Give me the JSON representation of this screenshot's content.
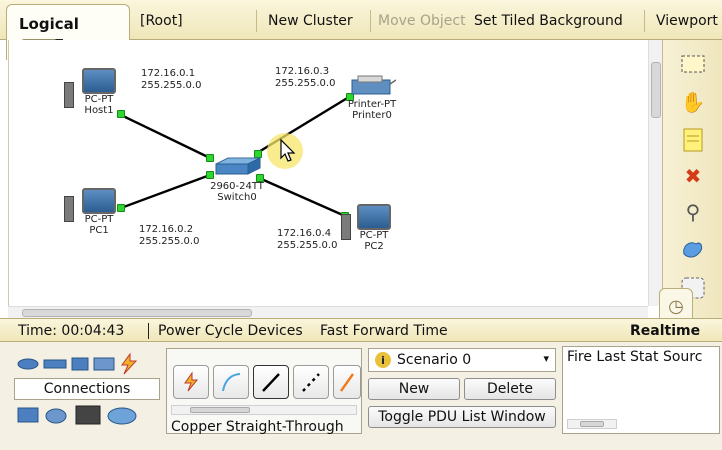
{
  "toolbar": {
    "logical": "Logical",
    "root": "[Root]",
    "new_cluster": "New Cluster",
    "move_object": "Move Object",
    "set_tiled_background": "Set Tiled Background",
    "viewport": "Viewport"
  },
  "devices": {
    "host1": {
      "type": "PC-PT",
      "name": "Host1",
      "ip": "172.16.0.1",
      "mask": "255.255.0.0"
    },
    "pc1": {
      "type": "PC-PT",
      "name": "PC1",
      "ip": "172.16.0.2",
      "mask": "255.255.0.0"
    },
    "switch0": {
      "type": "2960-24TT",
      "name": "Switch0"
    },
    "printer0": {
      "type": "Printer-PT",
      "name": "Printer0",
      "ip": "172.16.0.3",
      "mask": "255.255.0.0"
    },
    "pc2": {
      "type": "PC-PT",
      "name": "PC2",
      "ip": "172.16.0.4",
      "mask": "255.255.0.0"
    }
  },
  "time_bar": {
    "time": "Time: 00:04:43",
    "power_cycle": "Power Cycle Devices",
    "fast_forward": "Fast Forward Time",
    "mode": "Realtime"
  },
  "bottom": {
    "connections_label": "Connections",
    "cable_name": "Copper Straight-Through",
    "scenario": "Scenario 0",
    "new": "New",
    "delete": "Delete",
    "toggle_pdu": "Toggle PDU List Window",
    "pdu_columns": "Fire Last Stat Sourc"
  },
  "colors": {
    "link_light": "#2fd62f",
    "toolbar_bg": "#f3ebc6",
    "pointer_highlight": "#f7e56a"
  }
}
